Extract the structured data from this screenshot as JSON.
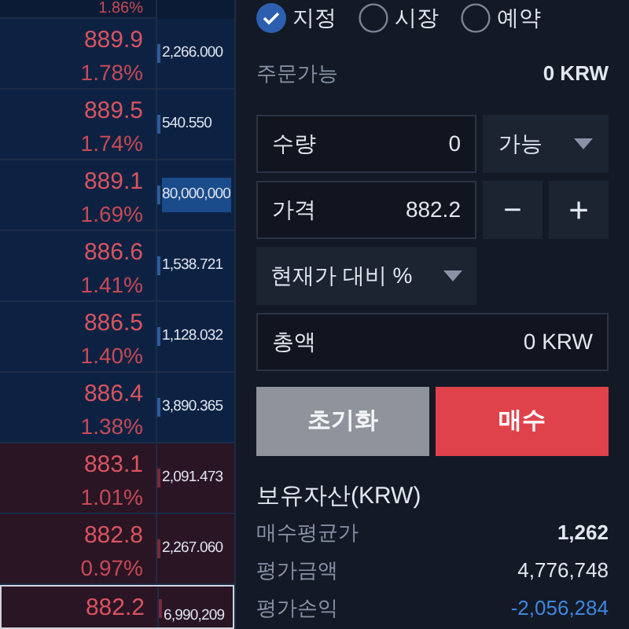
{
  "order_book": {
    "top_partial_percent": "1.86%",
    "rows": [
      {
        "price": "889.9",
        "percent": "1.78%",
        "volume": "2,266.000",
        "kind": "ask",
        "highlighted": false,
        "current": false
      },
      {
        "price": "889.5",
        "percent": "1.74%",
        "volume": "540.550",
        "kind": "ask",
        "highlighted": false,
        "current": false
      },
      {
        "price": "889.1",
        "percent": "1.69%",
        "volume": "80,000,000",
        "kind": "ask",
        "highlighted": true,
        "current": false
      },
      {
        "price": "886.6",
        "percent": "1.41%",
        "volume": "1,538.721",
        "kind": "ask",
        "highlighted": false,
        "current": false
      },
      {
        "price": "886.5",
        "percent": "1.40%",
        "volume": "1,128.032",
        "kind": "ask",
        "highlighted": false,
        "current": false
      },
      {
        "price": "886.4",
        "percent": "1.38%",
        "volume": "3,890.365",
        "kind": "ask",
        "highlighted": false,
        "current": false
      },
      {
        "price": "883.1",
        "percent": "1.01%",
        "volume": "2,091.473",
        "kind": "bid",
        "highlighted": false,
        "current": false
      },
      {
        "price": "882.8",
        "percent": "0.97%",
        "volume": "2,267.060",
        "kind": "bid",
        "highlighted": false,
        "current": false
      },
      {
        "price": "882.2",
        "volume": "6,990,209",
        "kind": "bid",
        "highlighted": false,
        "current": true
      }
    ]
  },
  "order_types": [
    {
      "label": "지정",
      "selected": true
    },
    {
      "label": "시장",
      "selected": false
    },
    {
      "label": "예약",
      "selected": false
    }
  ],
  "available": {
    "label": "주문가능",
    "value": "0 KRW"
  },
  "quantity": {
    "label": "수량",
    "value": "0",
    "dropdown": "가능"
  },
  "price": {
    "label": "가격",
    "value": "882.2",
    "minus": "−",
    "plus": "+"
  },
  "percent_dropdown": "현재가 대비 %",
  "total": {
    "label": "총액",
    "value": "0 KRW"
  },
  "buttons": {
    "reset": "초기화",
    "buy": "매수"
  },
  "holdings": {
    "title": "보유자산(KRW)",
    "rows": [
      {
        "label": "매수평균가",
        "value": "1,262",
        "kind": "bold"
      },
      {
        "label": "평가금액",
        "value": "4,776,748",
        "kind": "plain"
      },
      {
        "label": "평가손익",
        "value": "-2,056,284",
        "kind": "loss"
      }
    ]
  }
}
